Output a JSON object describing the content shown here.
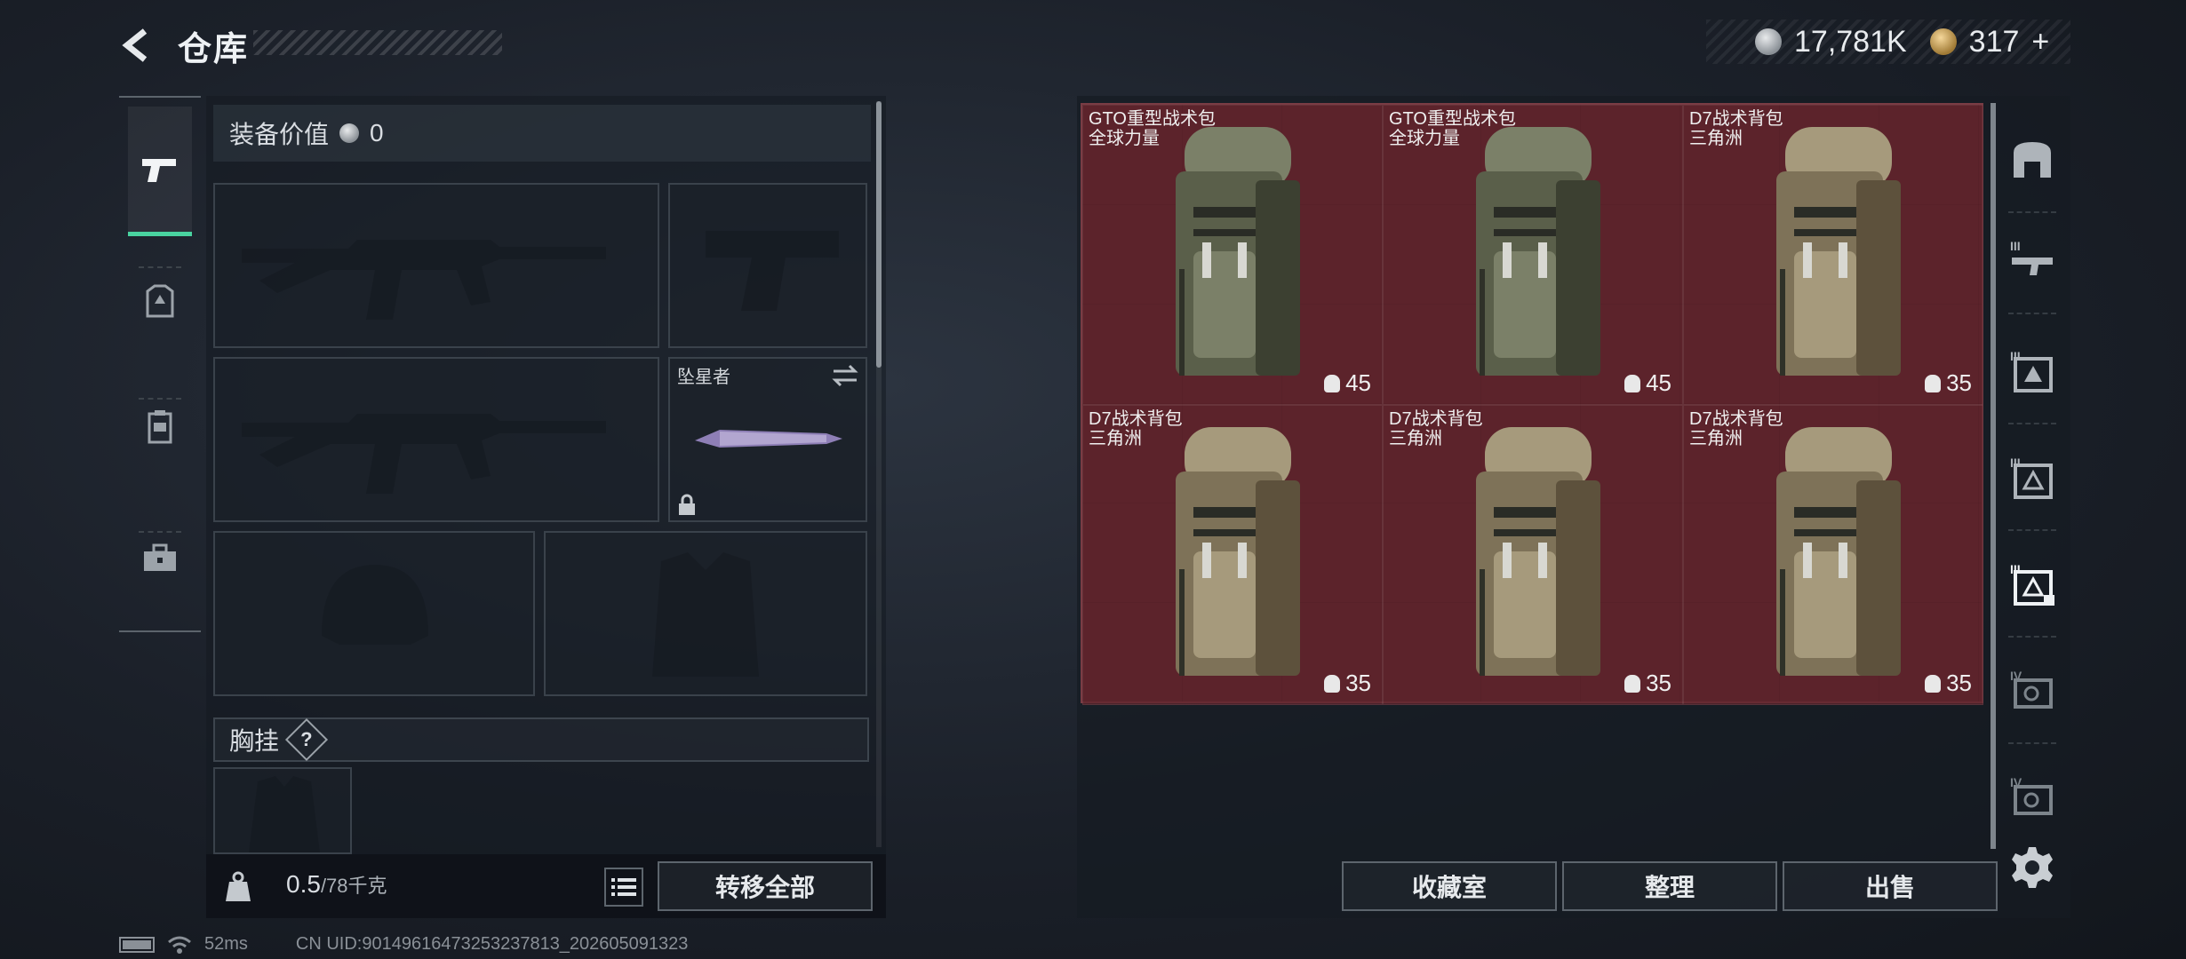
{
  "header": {
    "title": "仓库"
  },
  "currency": {
    "silver": "17,781K",
    "gold": "317"
  },
  "left_nav": [
    "pistol-icon",
    "armor-icon",
    "backpack-icon",
    "toolbox-icon"
  ],
  "loadout": {
    "value_label": "装备价值",
    "value": "0",
    "melee_name": "坠星者",
    "vest_label": "胸挂",
    "help": "?"
  },
  "weight": {
    "current": "0.5",
    "max": "/78千克"
  },
  "buttons": {
    "transfer_all": "转移全部",
    "collection": "收藏室",
    "organize": "整理",
    "sell": "出售"
  },
  "items": [
    {
      "name": "GTO重型战术包",
      "brand": "全球力量",
      "capacity": "45"
    },
    {
      "name": "GTO重型战术包",
      "brand": "全球力量",
      "capacity": "45"
    },
    {
      "name": "D7战术背包",
      "brand": "三角洲",
      "capacity": "35"
    },
    {
      "name": "D7战术背包",
      "brand": "三角洲",
      "capacity": "35"
    },
    {
      "name": "D7战术背包",
      "brand": "三角洲",
      "capacity": "35"
    },
    {
      "name": "D7战术背包",
      "brand": "三角洲",
      "capacity": "35"
    }
  ],
  "side_tabs": [
    "",
    "III",
    "III",
    "III",
    "III",
    "IV",
    "IV"
  ],
  "status": {
    "ping": "52ms",
    "uid": "CN UID:9014961647325323781​3_202605091323"
  }
}
